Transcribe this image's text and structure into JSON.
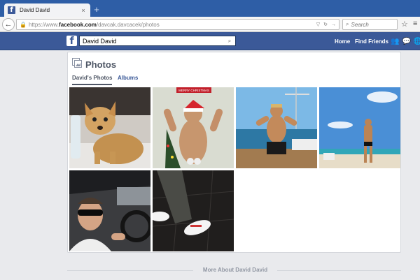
{
  "browser": {
    "tab_title": "David David",
    "tab_close": "×",
    "new_tab": "+",
    "back": "←",
    "url_prefix": "https://www.",
    "url_domain": "facebook.com",
    "url_path": "/davcak.davcacek/photos",
    "search_placeholder": "Search",
    "star_glyph": "☆",
    "menu_glyph": "≡"
  },
  "facebook": {
    "logo": "f",
    "search_value": "David David",
    "nav": {
      "home": "Home",
      "find_friends": "Find Friends"
    }
  },
  "photos_section": {
    "title": "Photos",
    "tabs": {
      "own_photos": "David's Photos",
      "albums": "Albums"
    },
    "christmas_banner": "MERRY CHRISTMAS",
    "thumbnails": [
      {
        "subject": "chihuahua-dog"
      },
      {
        "subject": "man-santa-hat-christmas-tree"
      },
      {
        "subject": "man-flexing-on-boat"
      },
      {
        "subject": "man-on-beach"
      },
      {
        "subject": "man-in-car-sunglasses"
      },
      {
        "subject": "white-sneakers-on-tile"
      }
    ]
  },
  "footer": {
    "more_about": "More About David David"
  },
  "colors": {
    "facebook_blue": "#3b5998",
    "tab_strip_blue": "#2e5ea6",
    "page_bg": "#e9eaed"
  }
}
